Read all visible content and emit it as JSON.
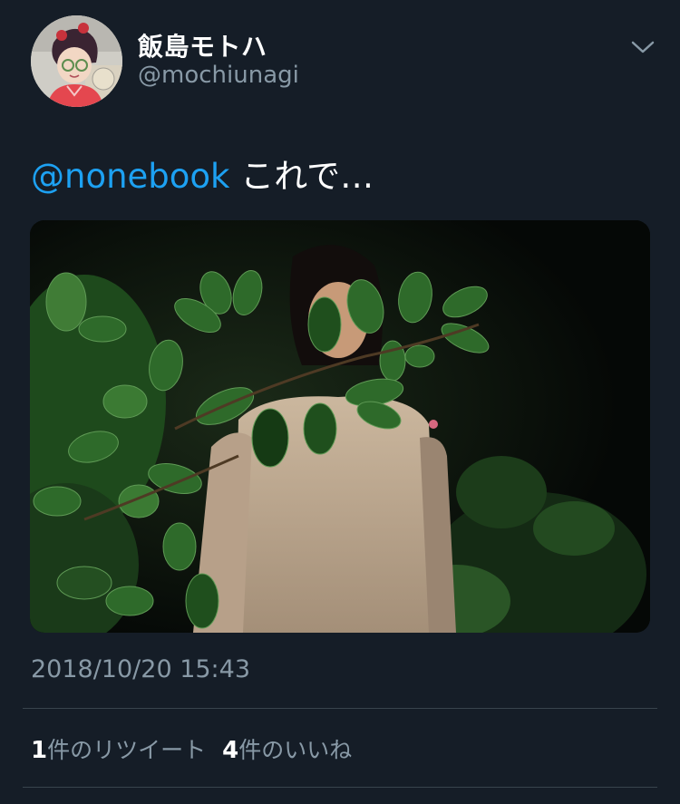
{
  "user": {
    "display_name": "飯島モトハ",
    "handle": "@mochiunagi"
  },
  "tweet": {
    "mention": "@nonebook",
    "text": " これで…"
  },
  "timestamp": "2018/10/20 15:43",
  "stats": {
    "retweet_count": "1",
    "retweet_label": "件のリツイート",
    "like_count": "4",
    "like_label": "件のいいね"
  },
  "colors": {
    "background": "#151d27",
    "mention": "#1da1f2",
    "secondary_text": "#8899a6",
    "divider": "#38444d"
  },
  "icons": {
    "menu": "chevron-down-icon"
  }
}
